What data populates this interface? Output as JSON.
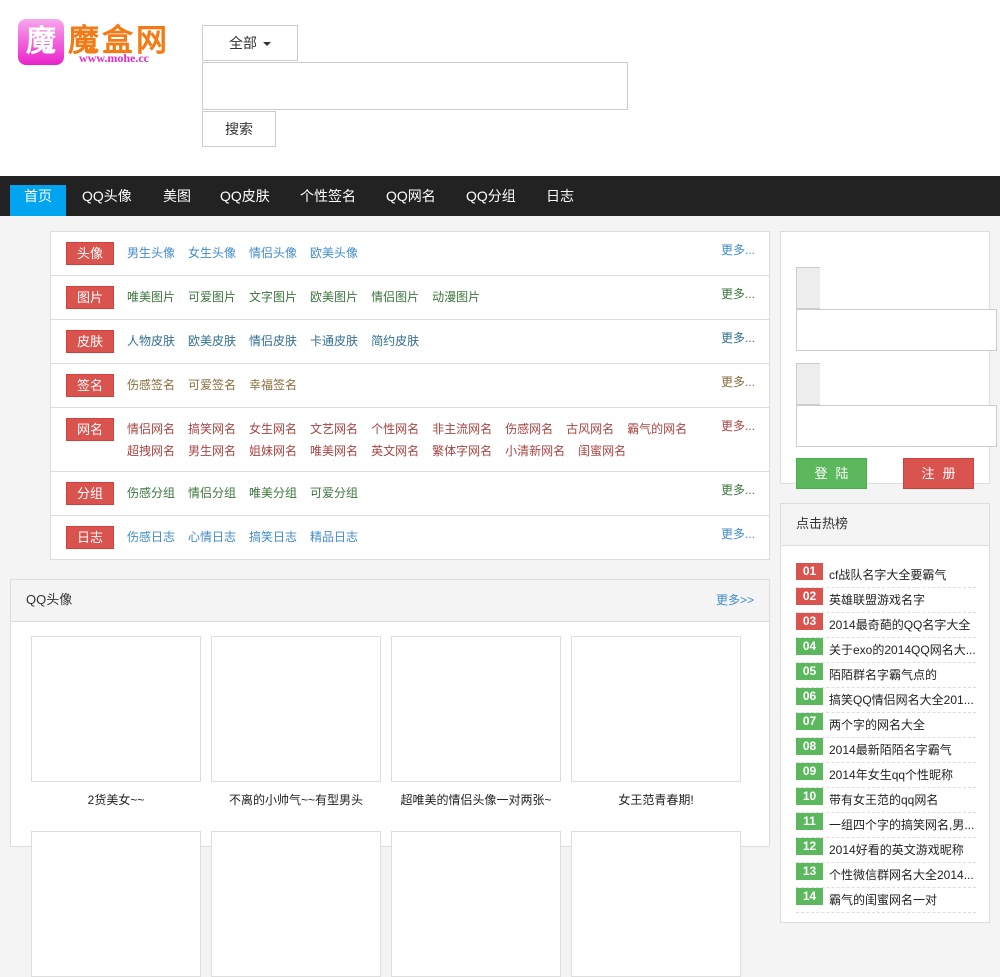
{
  "logo": {
    "mark": "魔",
    "name": "魔盒网",
    "url": "www.mohe.cc"
  },
  "search": {
    "scope": "全部",
    "value": "",
    "button": "搜索"
  },
  "nav": [
    "首页",
    "QQ头像",
    "美图",
    "QQ皮肤",
    "个性签名",
    "QQ网名",
    "QQ分组",
    "日志"
  ],
  "categories": [
    {
      "label": "头像",
      "color": "#428bca",
      "links": [
        "男生头像",
        "女生头像",
        "情侣头像",
        "欧美头像"
      ],
      "more": "更多..."
    },
    {
      "label": "图片",
      "color": "#3c763d",
      "links": [
        "唯美图片",
        "可爱图片",
        "文字图片",
        "欧美图片",
        "情侣图片",
        "动漫图片"
      ],
      "more": "更多..."
    },
    {
      "label": "皮肤",
      "color": "#31708f",
      "links": [
        "人物皮肤",
        "欧美皮肤",
        "情侣皮肤",
        "卡通皮肤",
        "简约皮肤"
      ],
      "more": "更多..."
    },
    {
      "label": "签名",
      "color": "#8a6d3b",
      "links": [
        "伤感签名",
        "可爱签名",
        "幸福签名"
      ],
      "more": "更多..."
    },
    {
      "label": "网名",
      "color": "#a94442",
      "links": [
        "情侣网名",
        "搞笑网名",
        "女生网名",
        "文艺网名",
        "个性网名",
        "非主流网名",
        "伤感网名",
        "古风网名",
        "霸气的网名",
        "超拽网名",
        "男生网名",
        "姐妹网名",
        "唯美网名",
        "英文网名",
        "繁体字网名",
        "小清新网名",
        "闺蜜网名"
      ],
      "more": "更多..."
    },
    {
      "label": "分组",
      "color": "#3c763d",
      "links": [
        "伤感分组",
        "情侣分组",
        "唯美分组",
        "可爱分组"
      ],
      "more": "更多..."
    },
    {
      "label": "日志",
      "color": "#428bca",
      "links": [
        "伤感日志",
        "心情日志",
        "搞笑日志",
        "精品日志"
      ],
      "more": "更多..."
    }
  ],
  "login": {
    "username": "",
    "password": "",
    "login_button": "登陆",
    "register_button": "注册"
  },
  "hot": {
    "title": "点击热榜",
    "items": [
      {
        "num": "01",
        "text": "cf战队名字大全要霸气"
      },
      {
        "num": "02",
        "text": "英雄联盟游戏名字"
      },
      {
        "num": "03",
        "text": "2014最奇葩的QQ名字大全"
      },
      {
        "num": "04",
        "text": "关于exo的2014QQ网名大..."
      },
      {
        "num": "05",
        "text": "陌陌群名字霸气点的"
      },
      {
        "num": "06",
        "text": "搞笑QQ情侣网名大全201..."
      },
      {
        "num": "07",
        "text": "两个字的网名大全"
      },
      {
        "num": "08",
        "text": "2014最新陌陌名字霸气"
      },
      {
        "num": "09",
        "text": "2014年女生qq个性昵称"
      },
      {
        "num": "10",
        "text": "带有女王范的qq网名"
      },
      {
        "num": "11",
        "text": "一组四个字的搞笑网名,男..."
      },
      {
        "num": "12",
        "text": "2014好看的英文游戏昵称"
      },
      {
        "num": "13",
        "text": "个性微信群网名大全2014..."
      },
      {
        "num": "14",
        "text": "霸气的闺蜜网名一对"
      }
    ],
    "top_color": "#d9534f",
    "rest_color": "#5cb85c"
  },
  "qq_panel": {
    "title": "QQ头像",
    "more": "更多>>",
    "items": [
      "2货美女~~",
      "不离的小帅气~~有型男头",
      "超唯美的情侣头像一对两张~",
      "女王范青春期!"
    ]
  }
}
